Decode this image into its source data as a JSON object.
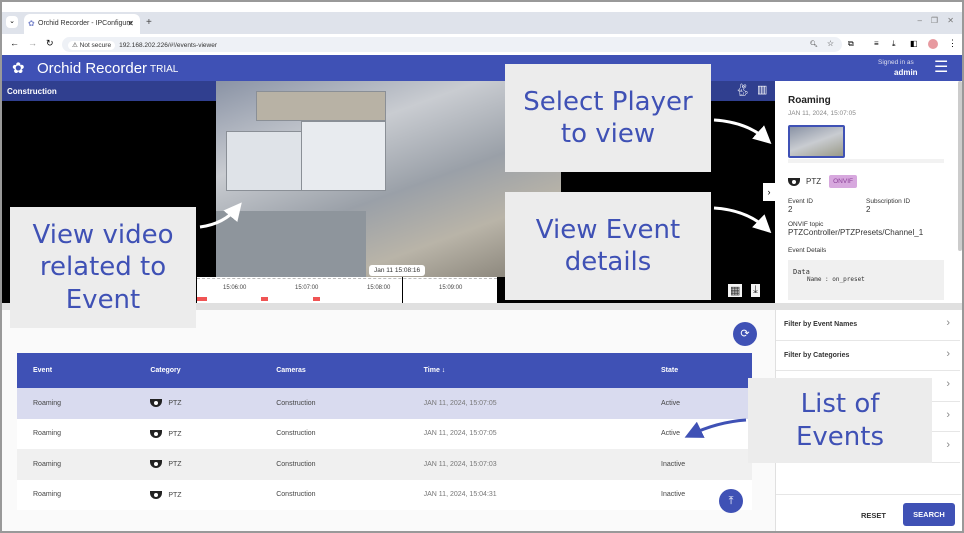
{
  "browser": {
    "tab_title": "Orchid Recorder - IPConfigure",
    "new_tab": "+",
    "not_secure": "Not secure",
    "url": "192.168.202.226/#!/events-viewer"
  },
  "app": {
    "brand": "Orchid Recorder",
    "edition": "TRIAL",
    "signed_in_label": "Signed in as",
    "user": "admin"
  },
  "video": {
    "camera_name": "Construction",
    "cursor_time": "Jan 11 15:08:16",
    "ticks": [
      "15:06:00",
      "15:07:00",
      "15:08:00",
      "15:09:00"
    ]
  },
  "details": {
    "title": "Roaming",
    "timestamp": "JAN 11, 2024, 15:07:05",
    "category": "PTZ",
    "badge": "ONVIF",
    "event_id_label": "Event ID",
    "event_id": "2",
    "subscription_id_label": "Subscription ID",
    "subscription_id": "2",
    "onvif_topic_label": "ONVIF topic",
    "onvif_topic": "PTZController/PTZPresets/Channel_1",
    "event_details_label": "Event Details",
    "data_heading": "Data",
    "data_line": "Name : on_preset"
  },
  "table": {
    "headers": {
      "event": "Event",
      "category": "Category",
      "cameras": "Cameras",
      "time": "Time ↓",
      "state": "State"
    },
    "rows": [
      {
        "event": "Roaming",
        "category": "PTZ",
        "camera": "Construction",
        "time": "JAN 11, 2024, 15:07:05",
        "state": "Active"
      },
      {
        "event": "Roaming",
        "category": "PTZ",
        "camera": "Construction",
        "time": "JAN 11, 2024, 15:07:05",
        "state": "Active"
      },
      {
        "event": "Roaming",
        "category": "PTZ",
        "camera": "Construction",
        "time": "JAN 11, 2024, 15:07:03",
        "state": "Inactive"
      },
      {
        "event": "Roaming",
        "category": "PTZ",
        "camera": "Construction",
        "time": "JAN 11, 2024, 15:04:31",
        "state": "Inactive"
      }
    ]
  },
  "filters": {
    "items": [
      "Filter by Event Names",
      "Filter by Categories",
      "",
      "",
      ""
    ],
    "reset": "RESET",
    "search": "SEARCH"
  },
  "callouts": {
    "player": "Select Player to view",
    "details": "View Event details",
    "video": "View video related to Event",
    "list": "List of Events"
  },
  "colors": {
    "brand": "#3f51b5",
    "accent_badge": "#d7a8de",
    "timeline_marker": "#f05454"
  }
}
